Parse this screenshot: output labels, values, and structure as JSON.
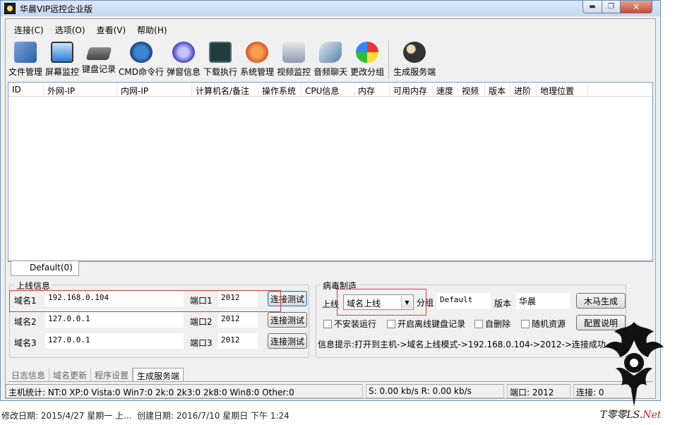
{
  "window": {
    "title": "华晨VIP远控企业版",
    "controls": {
      "min": "▬",
      "max": "❐",
      "close": "✕"
    }
  },
  "menu": [
    "连接(C)",
    "选项(O)",
    "查看(V)",
    "帮助(H)"
  ],
  "toolbar": [
    {
      "label": "文件管理",
      "icon": "file-manager-icon"
    },
    {
      "label": "屏幕监控",
      "icon": "monitor-icon"
    },
    {
      "label": "键盘记录",
      "icon": "keyboard-icon"
    },
    {
      "label": "CMD命令行",
      "icon": "cmd-icon"
    },
    {
      "label": "弹窗信息",
      "icon": "popup-icon"
    },
    {
      "label": "下载执行",
      "icon": "download-icon"
    },
    {
      "label": "系统管理",
      "icon": "system-icon"
    },
    {
      "label": "视频监控",
      "icon": "webcam-icon"
    },
    {
      "label": "音频聊天",
      "icon": "audio-icon"
    },
    {
      "label": "更改分组",
      "icon": "group-icon"
    },
    {
      "label": "生成服务端",
      "icon": "build-server-icon"
    }
  ],
  "list": {
    "columns": [
      "ID",
      "外网-IP",
      "内网-IP",
      "计算机名/备注",
      "操作系统",
      "CPU信息",
      "内存",
      "可用内存",
      "速度",
      "视频",
      "版本",
      "进阶",
      "地理位置"
    ]
  },
  "group_tab": "Default(0)",
  "online": {
    "title": "上线信息",
    "rows": [
      {
        "domain_label": "域名1",
        "domain": "192.168.0.104",
        "port_label": "端口1",
        "port": "2012",
        "button": "连接测试"
      },
      {
        "domain_label": "域名2",
        "domain": "127.0.0.1",
        "port_label": "端口2",
        "port": "2012",
        "button": "连接测试"
      },
      {
        "domain_label": "域名3",
        "domain": "127.0.0.1",
        "port_label": "端口3",
        "port": "2012",
        "button": "连接测试"
      }
    ]
  },
  "builder": {
    "title": "病毒制造",
    "online_label": "上线",
    "online_mode": "域名上线",
    "group_label": "分组",
    "group_value": "Default",
    "version_label": "版本",
    "version_value": "华晨",
    "build_button": "木马生成",
    "config_button": "配置说明",
    "checkboxes": [
      "不安装运行",
      "开启离线键盘记录",
      "自删除",
      "随机资源"
    ],
    "info": "信息提示:打开到主机->域名上线模式->192.168.0.104->2012->连接成功"
  },
  "bottom_tabs": [
    "日志信息",
    "域名更新",
    "程序设置",
    "生成服务端"
  ],
  "status": {
    "hosts": "主机统计:  NT:0  XP:0  Vista:0  Win7:0  2k:0  2k3:0  2k8:0  Win8:0  Other:0",
    "speed": "S: 0.00 kb/s R: 0.00 kb/s",
    "port": "端口: 2012",
    "connections": "连接: 0"
  },
  "footer": {
    "modified": "修改日期:  2015/4/27 星期一 上...",
    "created": "创建日期:  2016/7/10 星期日 下午 1:24",
    "watermark": "T",
    "watermark_mid": "零零LS.",
    "watermark_net": "Net"
  }
}
